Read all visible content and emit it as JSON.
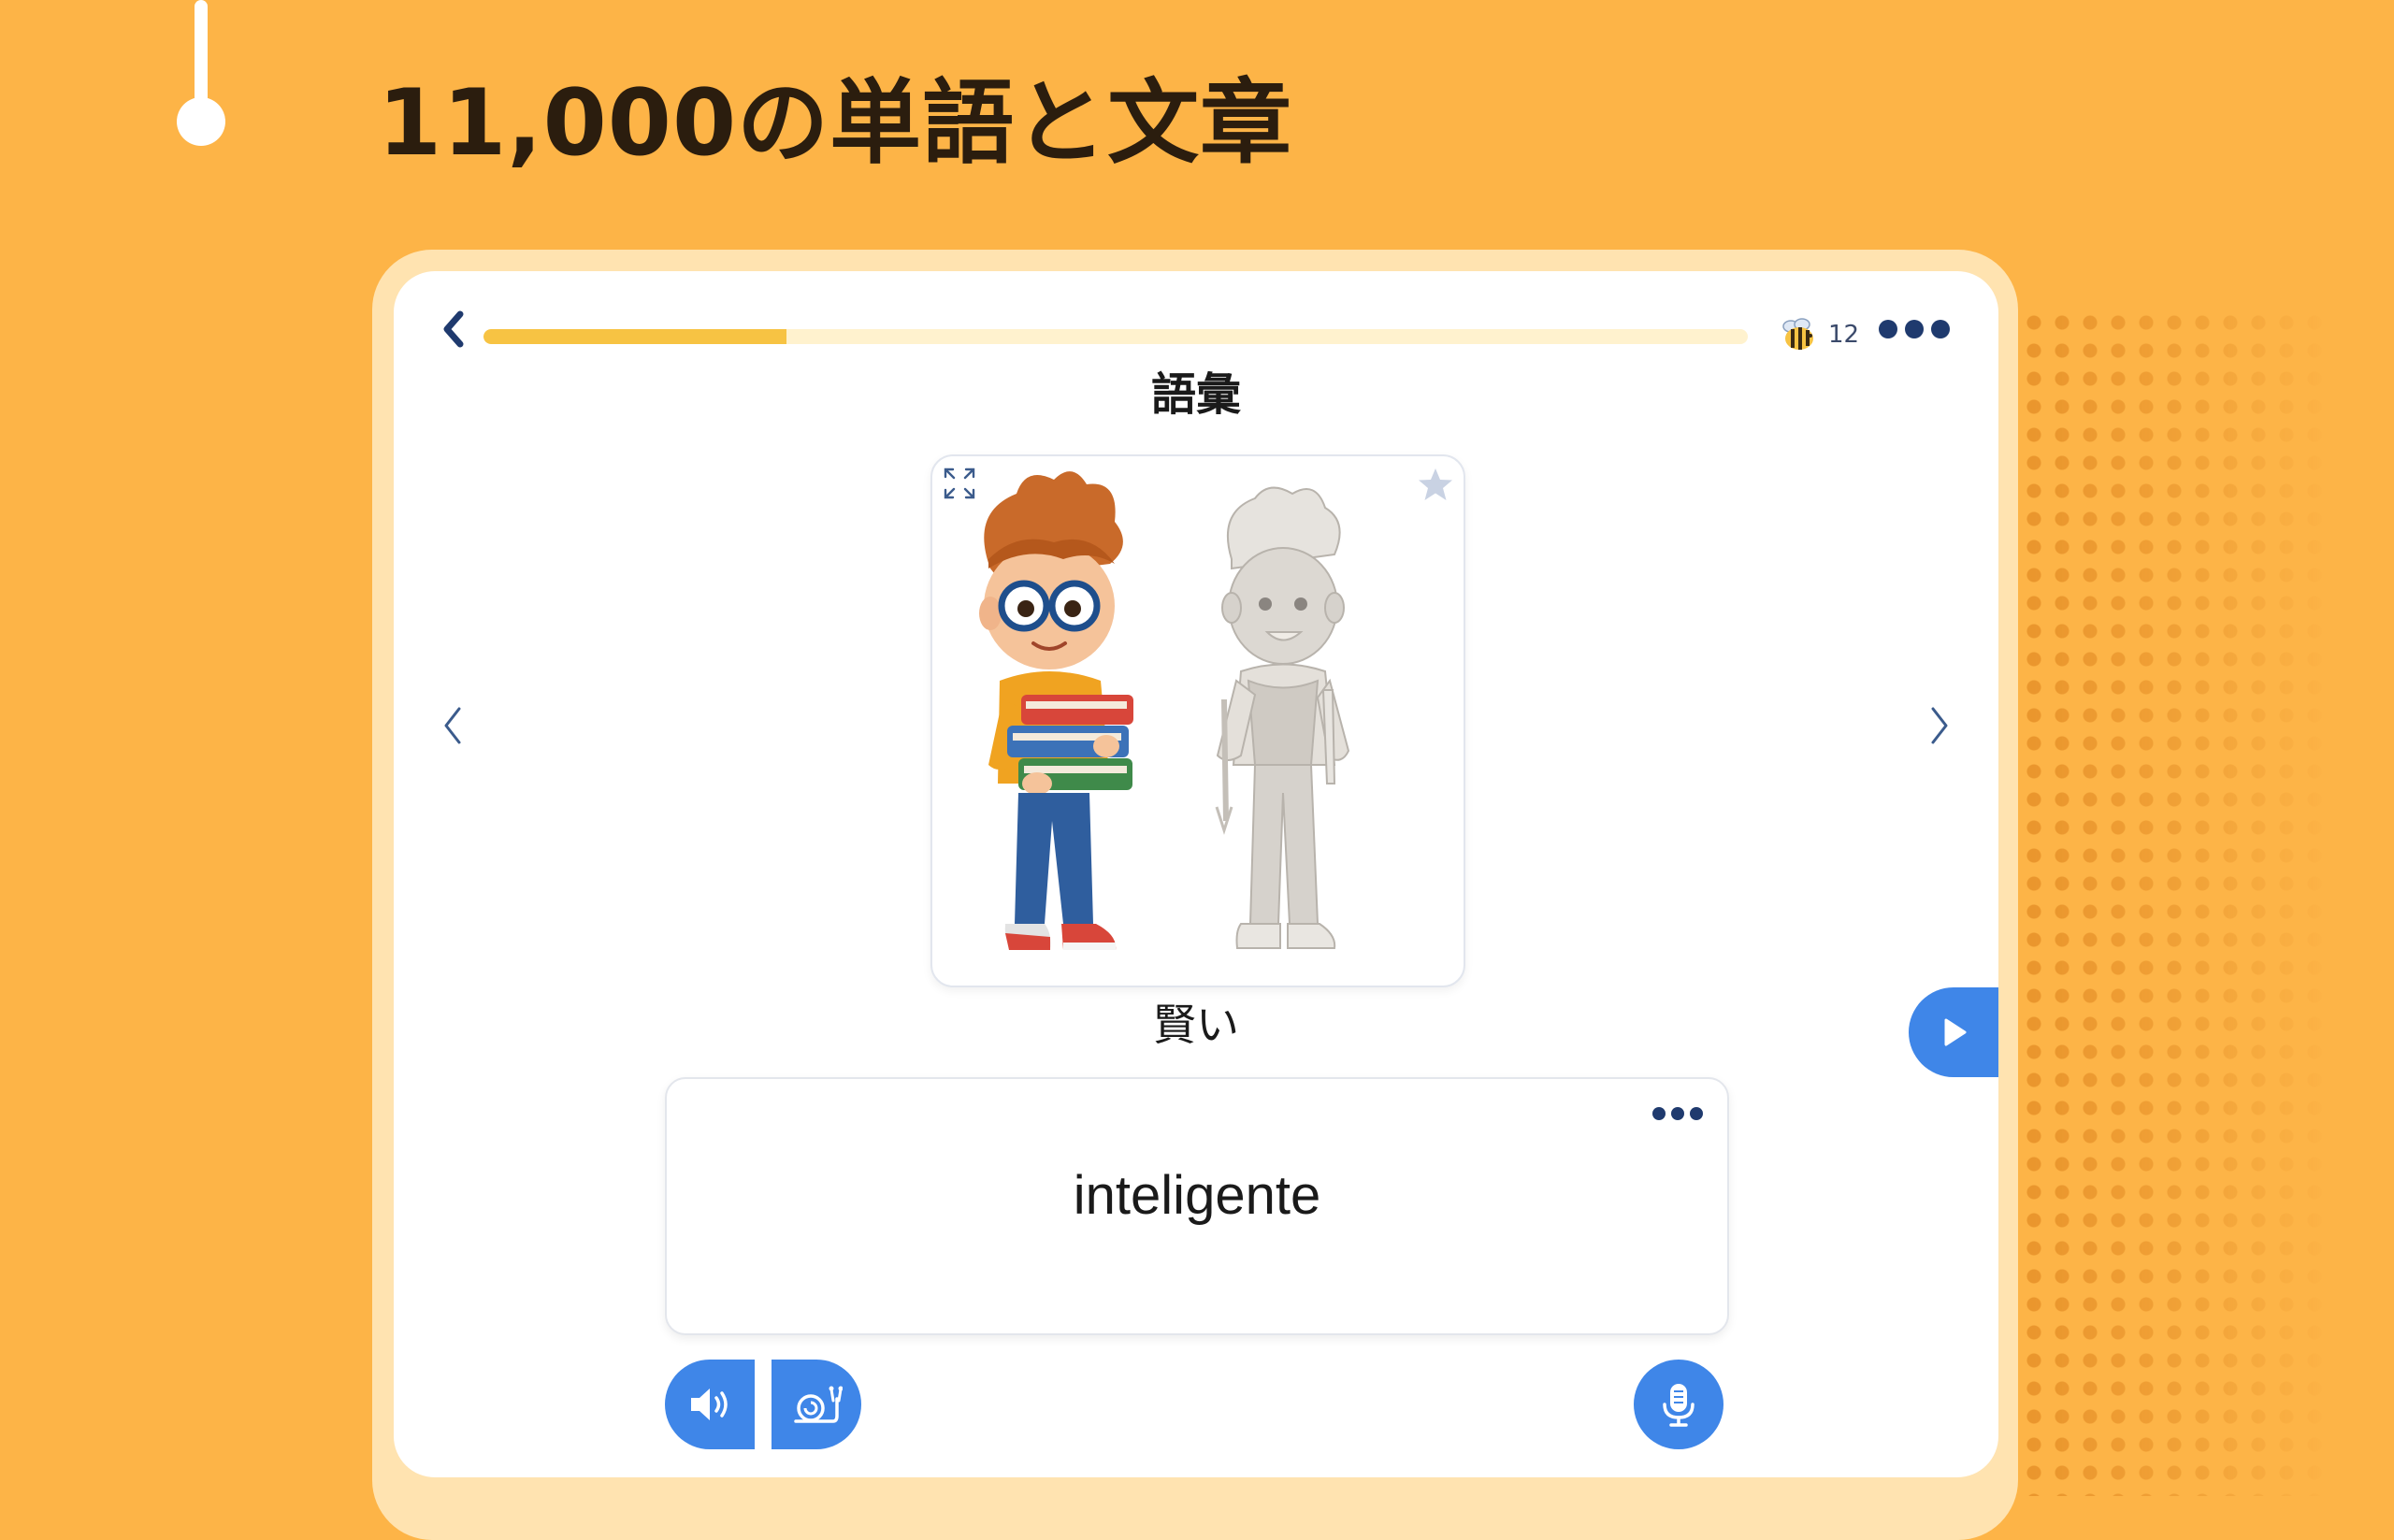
{
  "headline": "11,000の単語と文章",
  "header": {
    "progress_percent": 24,
    "bee_icon": "bee-icon",
    "bee_count": "12"
  },
  "section_title": "語彙",
  "flashcard": {
    "image_icons": [
      "expand-icon",
      "star-icon"
    ],
    "illustration": "boy-with-books-illustration",
    "word_jp": "賢い",
    "answer": "inteligente"
  },
  "colors": {
    "background": "#FDB447",
    "accent_blue": "#3F86E8",
    "progress": "#F7C343",
    "navy": "#1F3A6E"
  }
}
